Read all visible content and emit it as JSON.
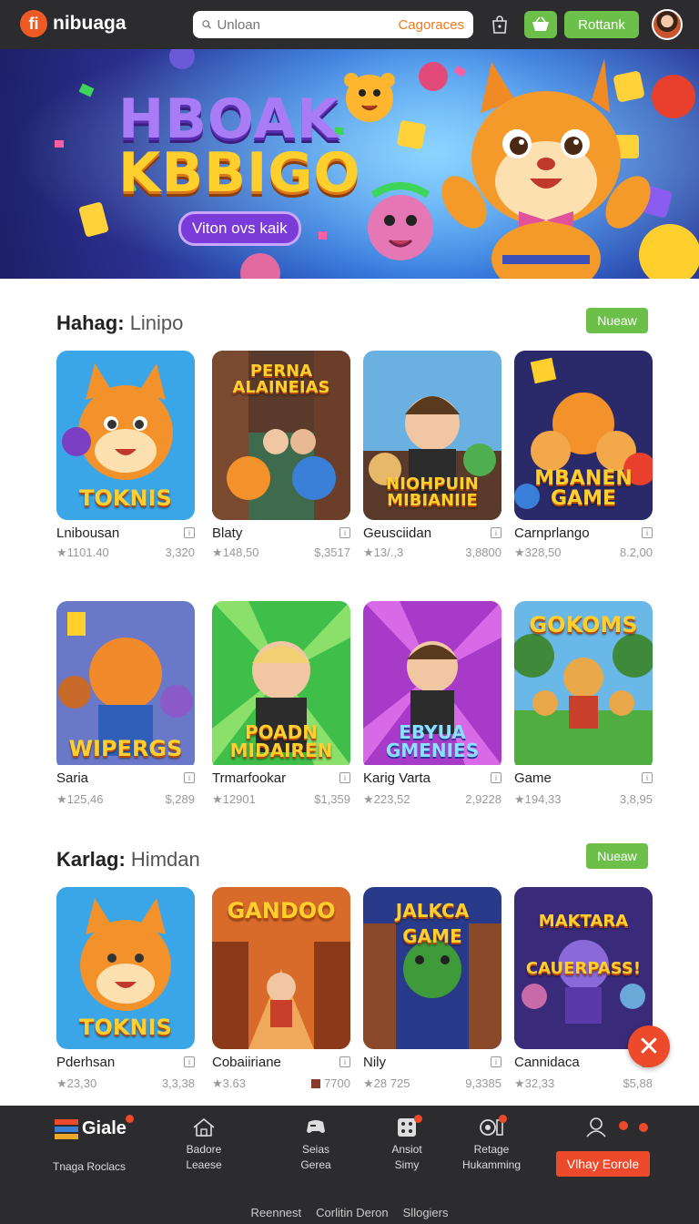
{
  "header": {
    "logo_mark": "fi",
    "logo_text": "nibuaga",
    "search_placeholder": "Unloan",
    "search_category": "Cagoraces",
    "rank_label": "Rottank"
  },
  "hero": {
    "title_line1": "HBOAK",
    "title_line2": "KBBIGO",
    "pill_label": "Viton ovs kaik"
  },
  "sections": [
    {
      "title_bold": "Hahag:",
      "title_rest": "Linipo",
      "button": "Nueaw",
      "rows": [
        [
          {
            "thumb_text": "TOKNIS",
            "name": "Lnibousan",
            "rating": "1101.40",
            "price": "3,320"
          },
          {
            "thumb_text": "PERNA ALAINEIAS",
            "name": "Blaty",
            "rating": "148,50",
            "price": "$,3517"
          },
          {
            "thumb_text": "NIOHPUIN MIBIANIIE",
            "name": "Geusciidan",
            "rating": "13/.,3",
            "price": "3,8800"
          },
          {
            "thumb_text": "MBANEN GAME",
            "name": "Carnprlango",
            "rating": "328,50",
            "price": "8.2,00"
          }
        ],
        [
          {
            "thumb_text": "WIPERGS",
            "name": "Saria",
            "rating": "125,46",
            "price": "$,289"
          },
          {
            "thumb_text": "POADN MIDAIREN",
            "name": "Trmarfookar",
            "rating": "12901",
            "price": "$1,359"
          },
          {
            "thumb_text": "EBYUA GMENIES",
            "name": "Karig Varta",
            "rating": "223,52",
            "price": "2,9228"
          },
          {
            "thumb_text": "GOKOMS",
            "name": "Game",
            "rating": "194,33",
            "price": "3,8,95"
          }
        ]
      ]
    },
    {
      "title_bold": "Karlag:",
      "title_rest": "Himdan",
      "button": "Nueaw",
      "rows": [
        [
          {
            "thumb_text": "TOKNIS",
            "name": "Pderhsan",
            "rating": "23,30",
            "price": "3,3,38"
          },
          {
            "thumb_text": "GANDOO",
            "name": "Cobaiiriane",
            "rating": "3.63",
            "price": "7700"
          },
          {
            "thumb_text": "JALKCA GAME",
            "name": "Nily",
            "rating": "28 725",
            "price": "9,3385"
          },
          {
            "thumb_text": "MAKTARA CAUERPASS!",
            "name": "Cannidaca",
            "rating": "32,33",
            "price": "$5,88"
          }
        ]
      ]
    }
  ],
  "bottom_nav": {
    "brand": "Giale",
    "brand_sub": "Tnaga Roclacs",
    "items": [
      {
        "line1": "Badore",
        "line2": "Leaese"
      },
      {
        "line1": "Seias",
        "line2": "Gerea"
      },
      {
        "line1": "Ansiot",
        "line2": "Simy"
      },
      {
        "line1": "Retage",
        "line2": "Hukamming"
      }
    ],
    "play_label": "Vlhay Eorole"
  },
  "footer": [
    "Reennest",
    "Corlitin Deron",
    "Sllogiers"
  ],
  "colors": {
    "accent_green": "#6cc04a",
    "accent_red": "#ec4a2a",
    "header_bg": "#2c2c2e"
  }
}
